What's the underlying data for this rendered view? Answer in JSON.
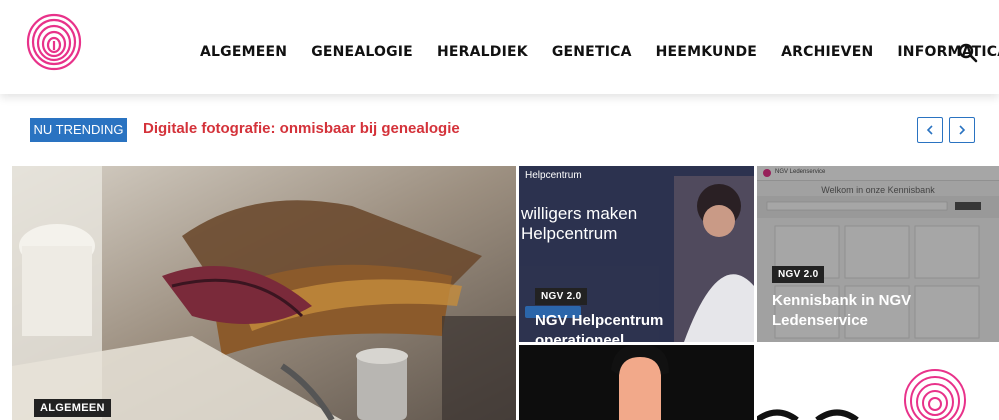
{
  "header": {
    "nav": [
      "ALGEMEEN",
      "GENEALOGIE",
      "HERALDIEK",
      "GENETICA",
      "HEEMKUNDE",
      "ARCHIEVEN",
      "INFORMATICA"
    ]
  },
  "trending": {
    "badge": "NU TRENDING",
    "title": "Digitale fotografie: onmisbaar bij genealogie"
  },
  "tiles": [
    {
      "category": "ALGEMEEN",
      "title": ""
    },
    {
      "category": "NGV 2.0",
      "title": "NGV Helpcentrum operationeel",
      "screen_brand": "Helpcentrum",
      "screen_heading": "willigers maken\nHelpcentrum"
    },
    {
      "category": "NGV 2.0",
      "title": "Kennisbank in NGV Ledenservice",
      "screen_brand": "NGV Ledenservice",
      "screen_heading": "Welkom in onze Kennisbank"
    }
  ],
  "colors": {
    "accent": "#2a73c1",
    "trending_title": "#d4323a",
    "logo": "#e8328a"
  },
  "icons": {
    "search": "search-icon",
    "prev": "chevron-left-icon",
    "next": "chevron-right-icon"
  }
}
